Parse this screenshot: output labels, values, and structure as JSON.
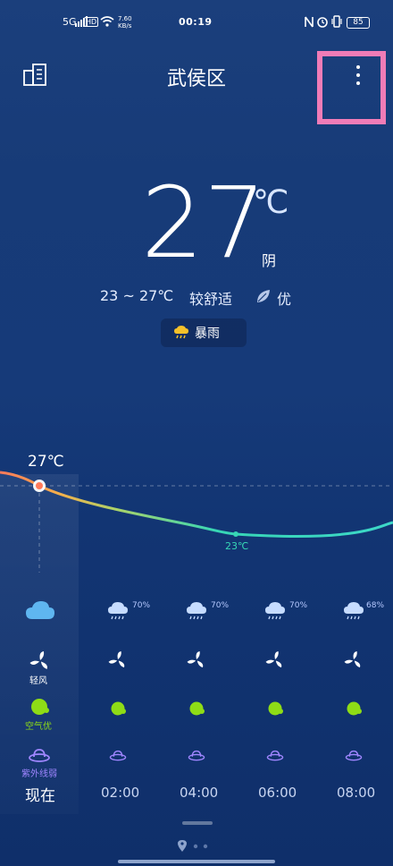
{
  "status_bar": {
    "time": "00:19",
    "network": "5G",
    "hd": "HD",
    "speed": "7.60 KB/s",
    "battery": "85"
  },
  "header": {
    "title": "武侯区"
  },
  "current": {
    "temp": "27",
    "unit": "℃",
    "condition": "阴",
    "range": "23 ~ 27℃",
    "comfort": "较舒适",
    "air_quality": "优",
    "alert": "暴雨"
  },
  "chart_data": {
    "type": "line",
    "current_temp_label": "27℃",
    "min_temp_label": "23℃",
    "x": [
      "现在",
      "02:00",
      "04:00",
      "06:00",
      "08:00"
    ],
    "y": [
      27,
      24.5,
      23,
      23,
      23.5
    ]
  },
  "forecast": [
    {
      "time": "现在",
      "icon": "cloud-icon",
      "precip": "",
      "wind_label": "轻风",
      "air_label": "空气优",
      "uv_label": "紫外线弱"
    },
    {
      "time": "02:00",
      "icon": "rain-cloud-icon",
      "precip": "70%"
    },
    {
      "time": "04:00",
      "icon": "rain-cloud-icon",
      "precip": "70%"
    },
    {
      "time": "06:00",
      "icon": "rain-cloud-icon",
      "precip": "70%"
    },
    {
      "time": "08:00",
      "icon": "rain-cloud-icon",
      "precip": "68%"
    }
  ],
  "colors": {
    "accent_pink": "#f07cb7",
    "air_green": "#8edc16",
    "uv_purple": "#9f86ff",
    "curve_min": "#37d6b5",
    "curve_start": "#ff7a5a"
  }
}
